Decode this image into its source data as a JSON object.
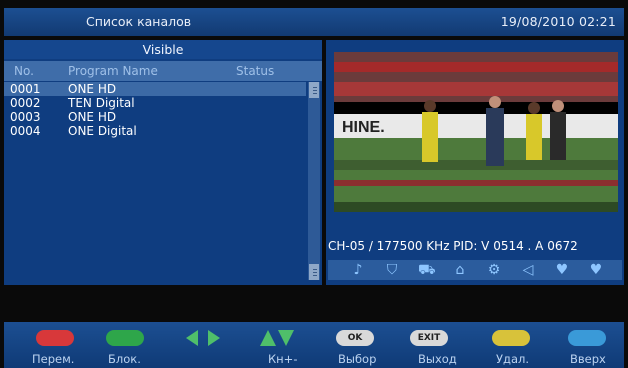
{
  "header": {
    "title": "Список каналов",
    "clock": "19/08/2010 02:21"
  },
  "list": {
    "group": "Visible",
    "columns": {
      "no": "No.",
      "name": "Program Name",
      "status": "Status"
    },
    "rows": [
      {
        "no": "0001",
        "name": "ONE HD"
      },
      {
        "no": "0002",
        "name": "TEN Digital"
      },
      {
        "no": "0003",
        "name": "ONE HD"
      },
      {
        "no": "0004",
        "name": "ONE Digital"
      }
    ]
  },
  "info": {
    "line": "CH-05 / 177500 KHz PID: V 0514 . A 0672"
  },
  "icons": [
    "music-icon",
    "shield-icon",
    "cart-icon",
    "lock-icon",
    "gear-icon",
    "satellite-icon",
    "heart-icon",
    "heart-icon"
  ],
  "footer": {
    "red_label": "Перем.",
    "green_label": "Блок.",
    "updown_label": "Кн+-",
    "ok_key": "OK",
    "ok_label": "Выбор",
    "exit_key": "EXIT",
    "exit_label": "Выход",
    "yellow_label": "Удал.",
    "blue_label": "Вверх"
  },
  "colors": {
    "red": "#d8383a",
    "green": "#2ea64a",
    "yellow": "#d8c23a",
    "blue": "#3a9ad8",
    "arrows": "#4fbf6a"
  }
}
